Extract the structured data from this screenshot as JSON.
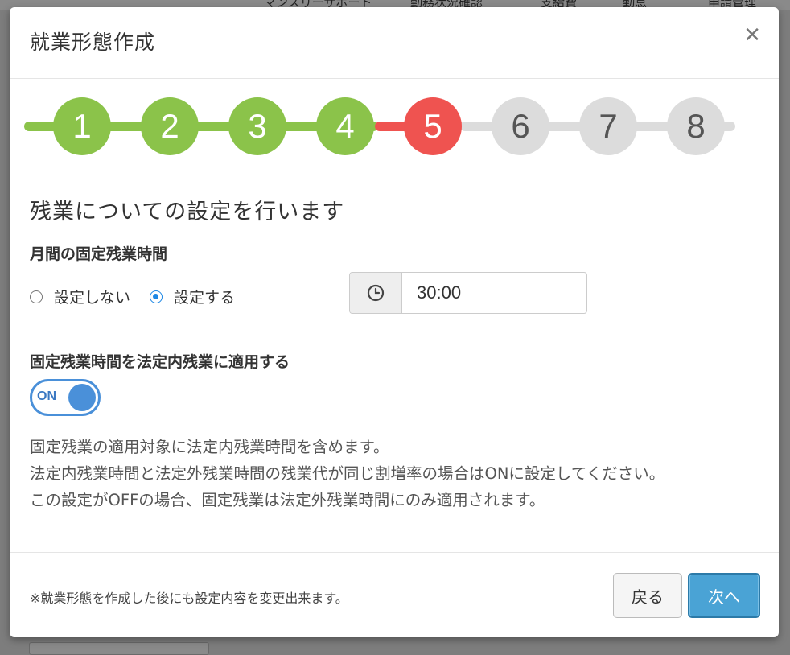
{
  "backdrop": {
    "nav_items": [
      "マンスリーサポート",
      "勤務状況確認",
      "支給費",
      "勤怠",
      "申請管理"
    ]
  },
  "dialog": {
    "title": "就業形態作成",
    "close_glyph": "✕"
  },
  "stepper": {
    "steps": [
      {
        "label": "1",
        "state": "done"
      },
      {
        "label": "2",
        "state": "done"
      },
      {
        "label": "3",
        "state": "done"
      },
      {
        "label": "4",
        "state": "done"
      },
      {
        "label": "5",
        "state": "current"
      },
      {
        "label": "6",
        "state": "todo"
      },
      {
        "label": "7",
        "state": "todo"
      },
      {
        "label": "8",
        "state": "todo"
      }
    ],
    "colors": {
      "done": "#8bc34a",
      "current": "#ef5350",
      "todo": "#dcdcdc"
    }
  },
  "content": {
    "heading": "残業についての設定を行います",
    "fixed_overtime": {
      "label": "月間の固定残業時間",
      "options": [
        {
          "label": "設定しない",
          "checked": false
        },
        {
          "label": "設定する",
          "checked": true
        }
      ],
      "time_icon": "clock-icon",
      "time_value": "30:00"
    },
    "apply_legal": {
      "label": "固定残業時間を法定内残業に適用する",
      "toggle_text": "ON",
      "toggle_on": true
    },
    "help_lines": [
      "固定残業の適用対象に法定内残業時間を含めます。",
      "法定内残業時間と法定外残業時間の残業代が同じ割増率の場合はONに設定してください。",
      "この設定がOFFの場合、固定残業は法定外残業時間にのみ適用されます。"
    ]
  },
  "footer": {
    "note": "※就業形態を作成した後にも設定内容を変更出来ます。",
    "back_label": "戻る",
    "next_label": "次へ"
  }
}
